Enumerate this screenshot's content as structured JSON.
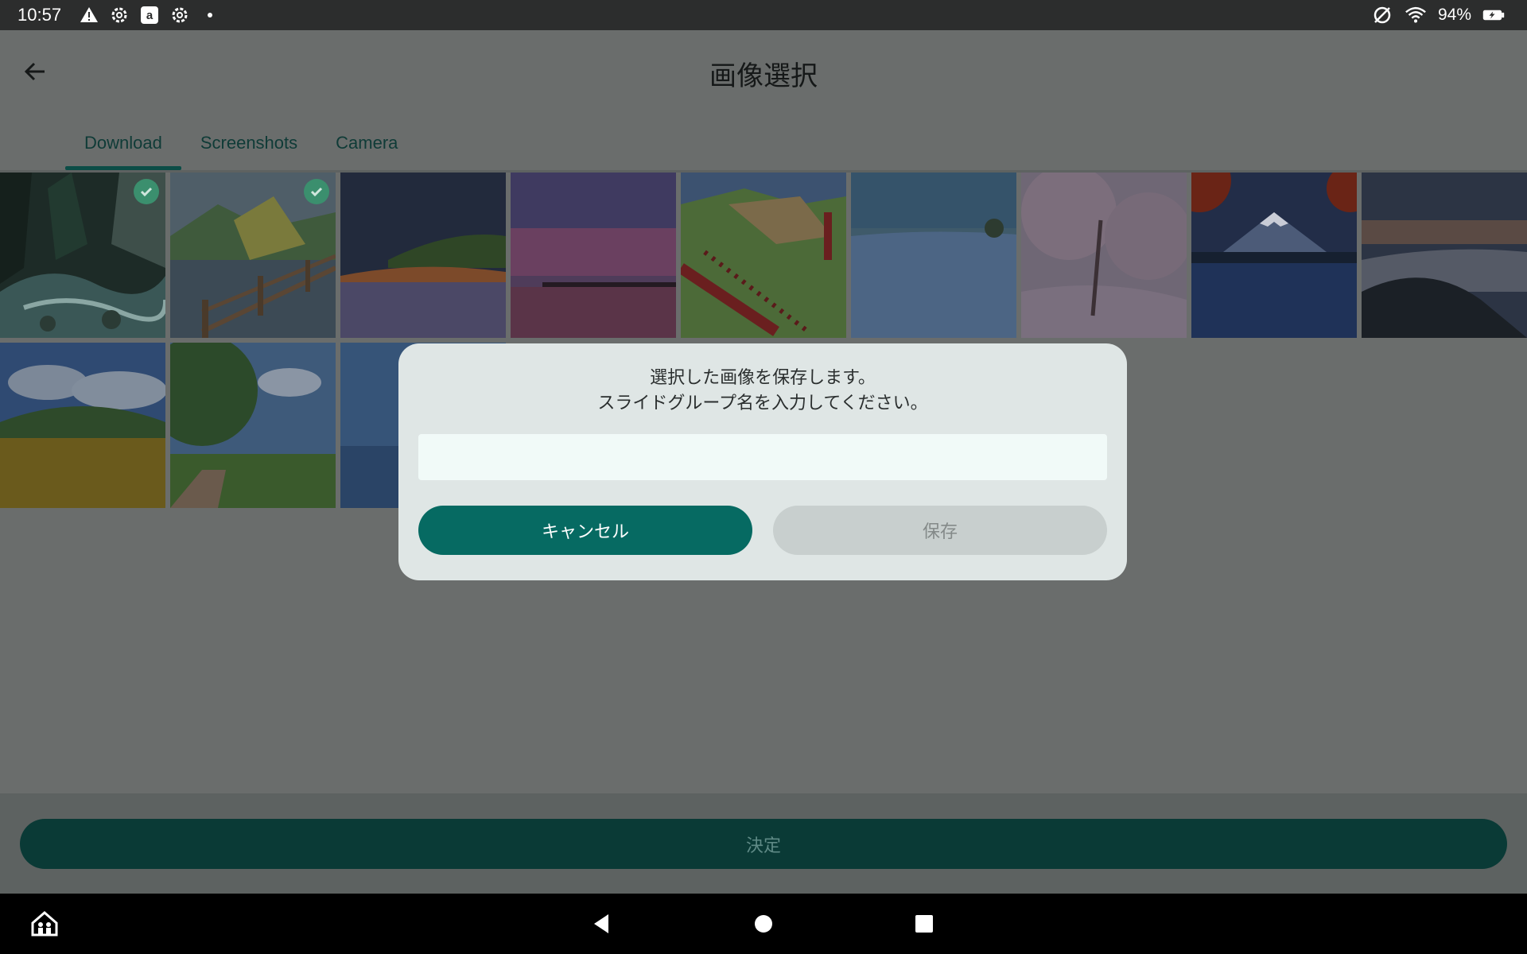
{
  "status_bar": {
    "time": "10:57",
    "left_icons": [
      "warning-icon",
      "settings-icon",
      "amazon-icon",
      "settings-icon",
      "dot-icon"
    ],
    "battery": "94%",
    "right_icons": [
      "no-sync-icon",
      "wifi-icon",
      "battery-charging-icon"
    ]
  },
  "header": {
    "title": "画像選択",
    "back_icon": "arrow-left-icon"
  },
  "tabs": [
    {
      "label": "Download",
      "active": true
    },
    {
      "label": "Screenshots",
      "active": false
    },
    {
      "label": "Camera",
      "active": false
    }
  ],
  "images": [
    {
      "subject": "forest-stream",
      "selected": true
    },
    {
      "subject": "lake-fence",
      "selected": true
    },
    {
      "subject": "flower-field-evening",
      "selected": false
    },
    {
      "subject": "pink-sunset-sea",
      "selected": false
    },
    {
      "subject": "red-torii-hill",
      "selected": false
    },
    {
      "subject": "blue-flower-field",
      "selected": false
    },
    {
      "subject": "cherry-blossoms",
      "selected": false
    },
    {
      "subject": "mount-fuji-lake",
      "selected": false
    },
    {
      "subject": "sea-of-clouds",
      "selected": false
    },
    {
      "subject": "sunflower-field",
      "selected": false
    },
    {
      "subject": "tree-field-path",
      "selected": false
    },
    {
      "subject": "ocean-horizon",
      "selected": false
    }
  ],
  "dialog": {
    "message_line1": "選択した画像を保存します。",
    "message_line2": "スライドグループ名を入力してください。",
    "input_value": "",
    "cancel_label": "キャンセル",
    "save_label": "保存"
  },
  "bottom": {
    "decide_label": "決定"
  },
  "navbar": {
    "icons": [
      "home-people-icon",
      "nav-back-icon",
      "nav-home-icon",
      "nav-recents-icon"
    ]
  },
  "colors": {
    "accent": "#066a62",
    "accent_dark": "#0a3a36",
    "scrim_background": "#6a6d6c"
  }
}
